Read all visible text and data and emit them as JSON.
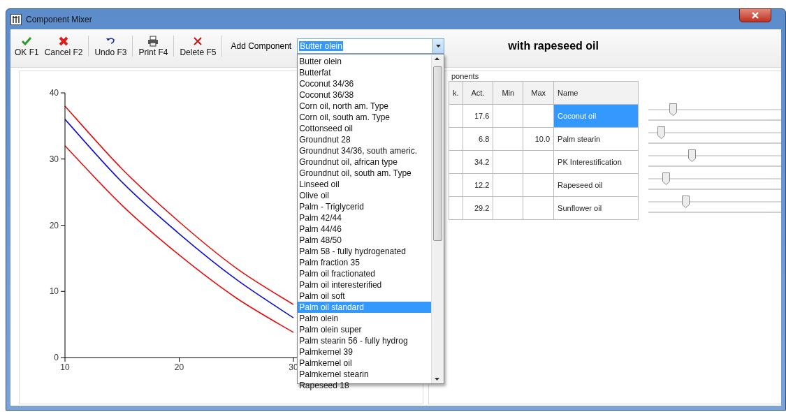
{
  "window": {
    "title": "Component Mixer"
  },
  "toolbar": {
    "buttons": [
      {
        "label": "OK F1",
        "kind": "ok"
      },
      {
        "label": "Cancel F2",
        "kind": "cancel"
      },
      {
        "label": "Undo F3",
        "kind": "undo"
      },
      {
        "label": "Print F4",
        "kind": "print"
      },
      {
        "label": "Delete F5",
        "kind": "delete"
      }
    ],
    "add_component": {
      "label": "Add Component",
      "value": "Butter olein"
    }
  },
  "heading": "with rapeseed oil",
  "chart": {
    "chart_data": {
      "type": "line",
      "x": [
        10,
        15,
        20,
        25,
        30
      ],
      "series": [
        {
          "color": "#e01010",
          "values": [
            38,
            28.5,
            20.5,
            13.5,
            8
          ]
        },
        {
          "color": "#1010d0",
          "values": [
            36,
            26.5,
            18.7,
            11.8,
            6
          ]
        },
        {
          "color": "#e01010",
          "values": [
            32,
            23,
            15.5,
            9,
            3.8
          ]
        }
      ],
      "xlim": [
        10,
        30.4
      ],
      "ylim": [
        0,
        40
      ],
      "xticks": [
        10,
        20,
        30
      ],
      "yticks": [
        0,
        10,
        20,
        30,
        40
      ]
    }
  },
  "dropdown": {
    "items": [
      {
        "label": "Butter olein",
        "selected": false
      },
      {
        "label": "Butterfat",
        "selected": false
      },
      {
        "label": "Coconut 34/36",
        "selected": false
      },
      {
        "label": "Coconut 36/38",
        "selected": false
      },
      {
        "label": "Corn oil, north am. Type",
        "selected": false
      },
      {
        "label": "Corn oil, south am. Type",
        "selected": false
      },
      {
        "label": "Cottonseed oil",
        "selected": false
      },
      {
        "label": "Groundnut 28",
        "selected": false
      },
      {
        "label": "Groundnut 34/36, south americ.",
        "selected": false
      },
      {
        "label": "Groundnut oil, african type",
        "selected": false
      },
      {
        "label": "Groundnut oil, south am. Type",
        "selected": false
      },
      {
        "label": "Linseed oil",
        "selected": false
      },
      {
        "label": "Olive oil",
        "selected": false
      },
      {
        "label": "Palm - Triglycerid",
        "selected": false
      },
      {
        "label": "Palm 42/44",
        "selected": false
      },
      {
        "label": "Palm 44/46",
        "selected": false
      },
      {
        "label": "Palm 48/50",
        "selected": false
      },
      {
        "label": "Palm 58  - fully hydrogenated",
        "selected": false
      },
      {
        "label": "Palm fraction 35",
        "selected": false
      },
      {
        "label": "Palm oil fractionated",
        "selected": false
      },
      {
        "label": "Palm oil interesterified",
        "selected": false
      },
      {
        "label": "Palm oil soft",
        "selected": false
      },
      {
        "label": "Palm oil standard",
        "selected": true
      },
      {
        "label": "Palm olein",
        "selected": false
      },
      {
        "label": "Palm olein super",
        "selected": false
      },
      {
        "label": "Palm stearin 56 - fully hydrog",
        "selected": false
      },
      {
        "label": "Palmkernel 39",
        "selected": false
      },
      {
        "label": "Palmkernel oil",
        "selected": false
      },
      {
        "label": "Palmkernel stearin",
        "selected": false
      },
      {
        "label": "Rapeseed 18",
        "selected": false
      }
    ]
  },
  "components": {
    "group_label": "ponents",
    "columns": [
      "k.",
      "Act.",
      "Min",
      "Max",
      "Name"
    ],
    "rows": [
      {
        "act": "17.6",
        "name": "Coconut oil",
        "selected": true
      },
      {
        "act": "6.8",
        "max": "10.0",
        "name": "Palm stearin",
        "selected": false
      },
      {
        "act": "34.2",
        "name": "PK Interestification",
        "selected": false
      },
      {
        "act": "12.2",
        "name": "Rapeseed oil",
        "selected": false
      },
      {
        "act": "29.2",
        "name": "Sunflower oil",
        "selected": false
      }
    ]
  },
  "sliders": [
    {
      "level": 0.2
    },
    {
      "level": 0.1
    },
    {
      "level": 0.35
    },
    {
      "level": 0.14
    },
    {
      "level": 0.3
    }
  ]
}
